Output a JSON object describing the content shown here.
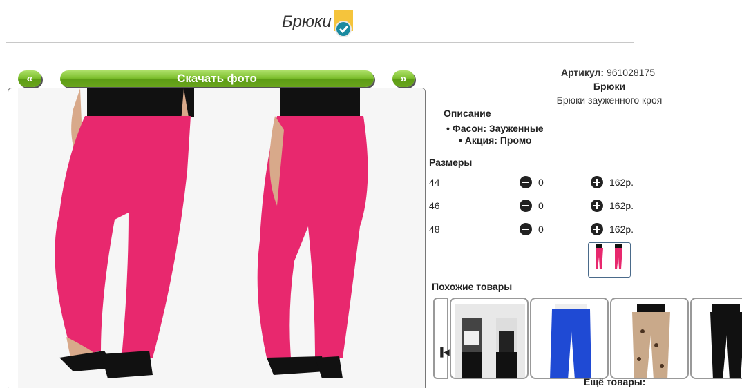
{
  "header": {
    "title": "Брюки"
  },
  "nav": {
    "prev_label": "«",
    "next_label": "»",
    "download_label": "Скачать фото"
  },
  "product": {
    "article_label": "Артикул:",
    "article_value": "961028175",
    "name": "Брюки",
    "subtitle": "Брюки зауженного кроя",
    "description_heading": "Описание",
    "features": [
      "Фасон: Зауженные",
      "Акция: Промо"
    ]
  },
  "sizes": {
    "heading": "Размеры",
    "rows": [
      {
        "size": "44",
        "qty": "0",
        "price": "162р."
      },
      {
        "size": "46",
        "qty": "0",
        "price": "162р."
      },
      {
        "size": "48",
        "qty": "0",
        "price": "162р."
      }
    ]
  },
  "similar": {
    "heading": "Похожие товары",
    "more_label": "Ещё товары:"
  },
  "colors": {
    "accent_green": "#7cbe2c",
    "pants_pink": "#e8286e",
    "badge_yellow": "#f5c43c",
    "badge_check": "#1a8aa0"
  },
  "icons": {
    "prev": "chevron-left-icon",
    "next": "chevron-right-icon",
    "minus": "minus-circle-icon",
    "plus": "plus-circle-icon",
    "badge": "verified-check-icon",
    "carousel": "skip-back-icon"
  }
}
